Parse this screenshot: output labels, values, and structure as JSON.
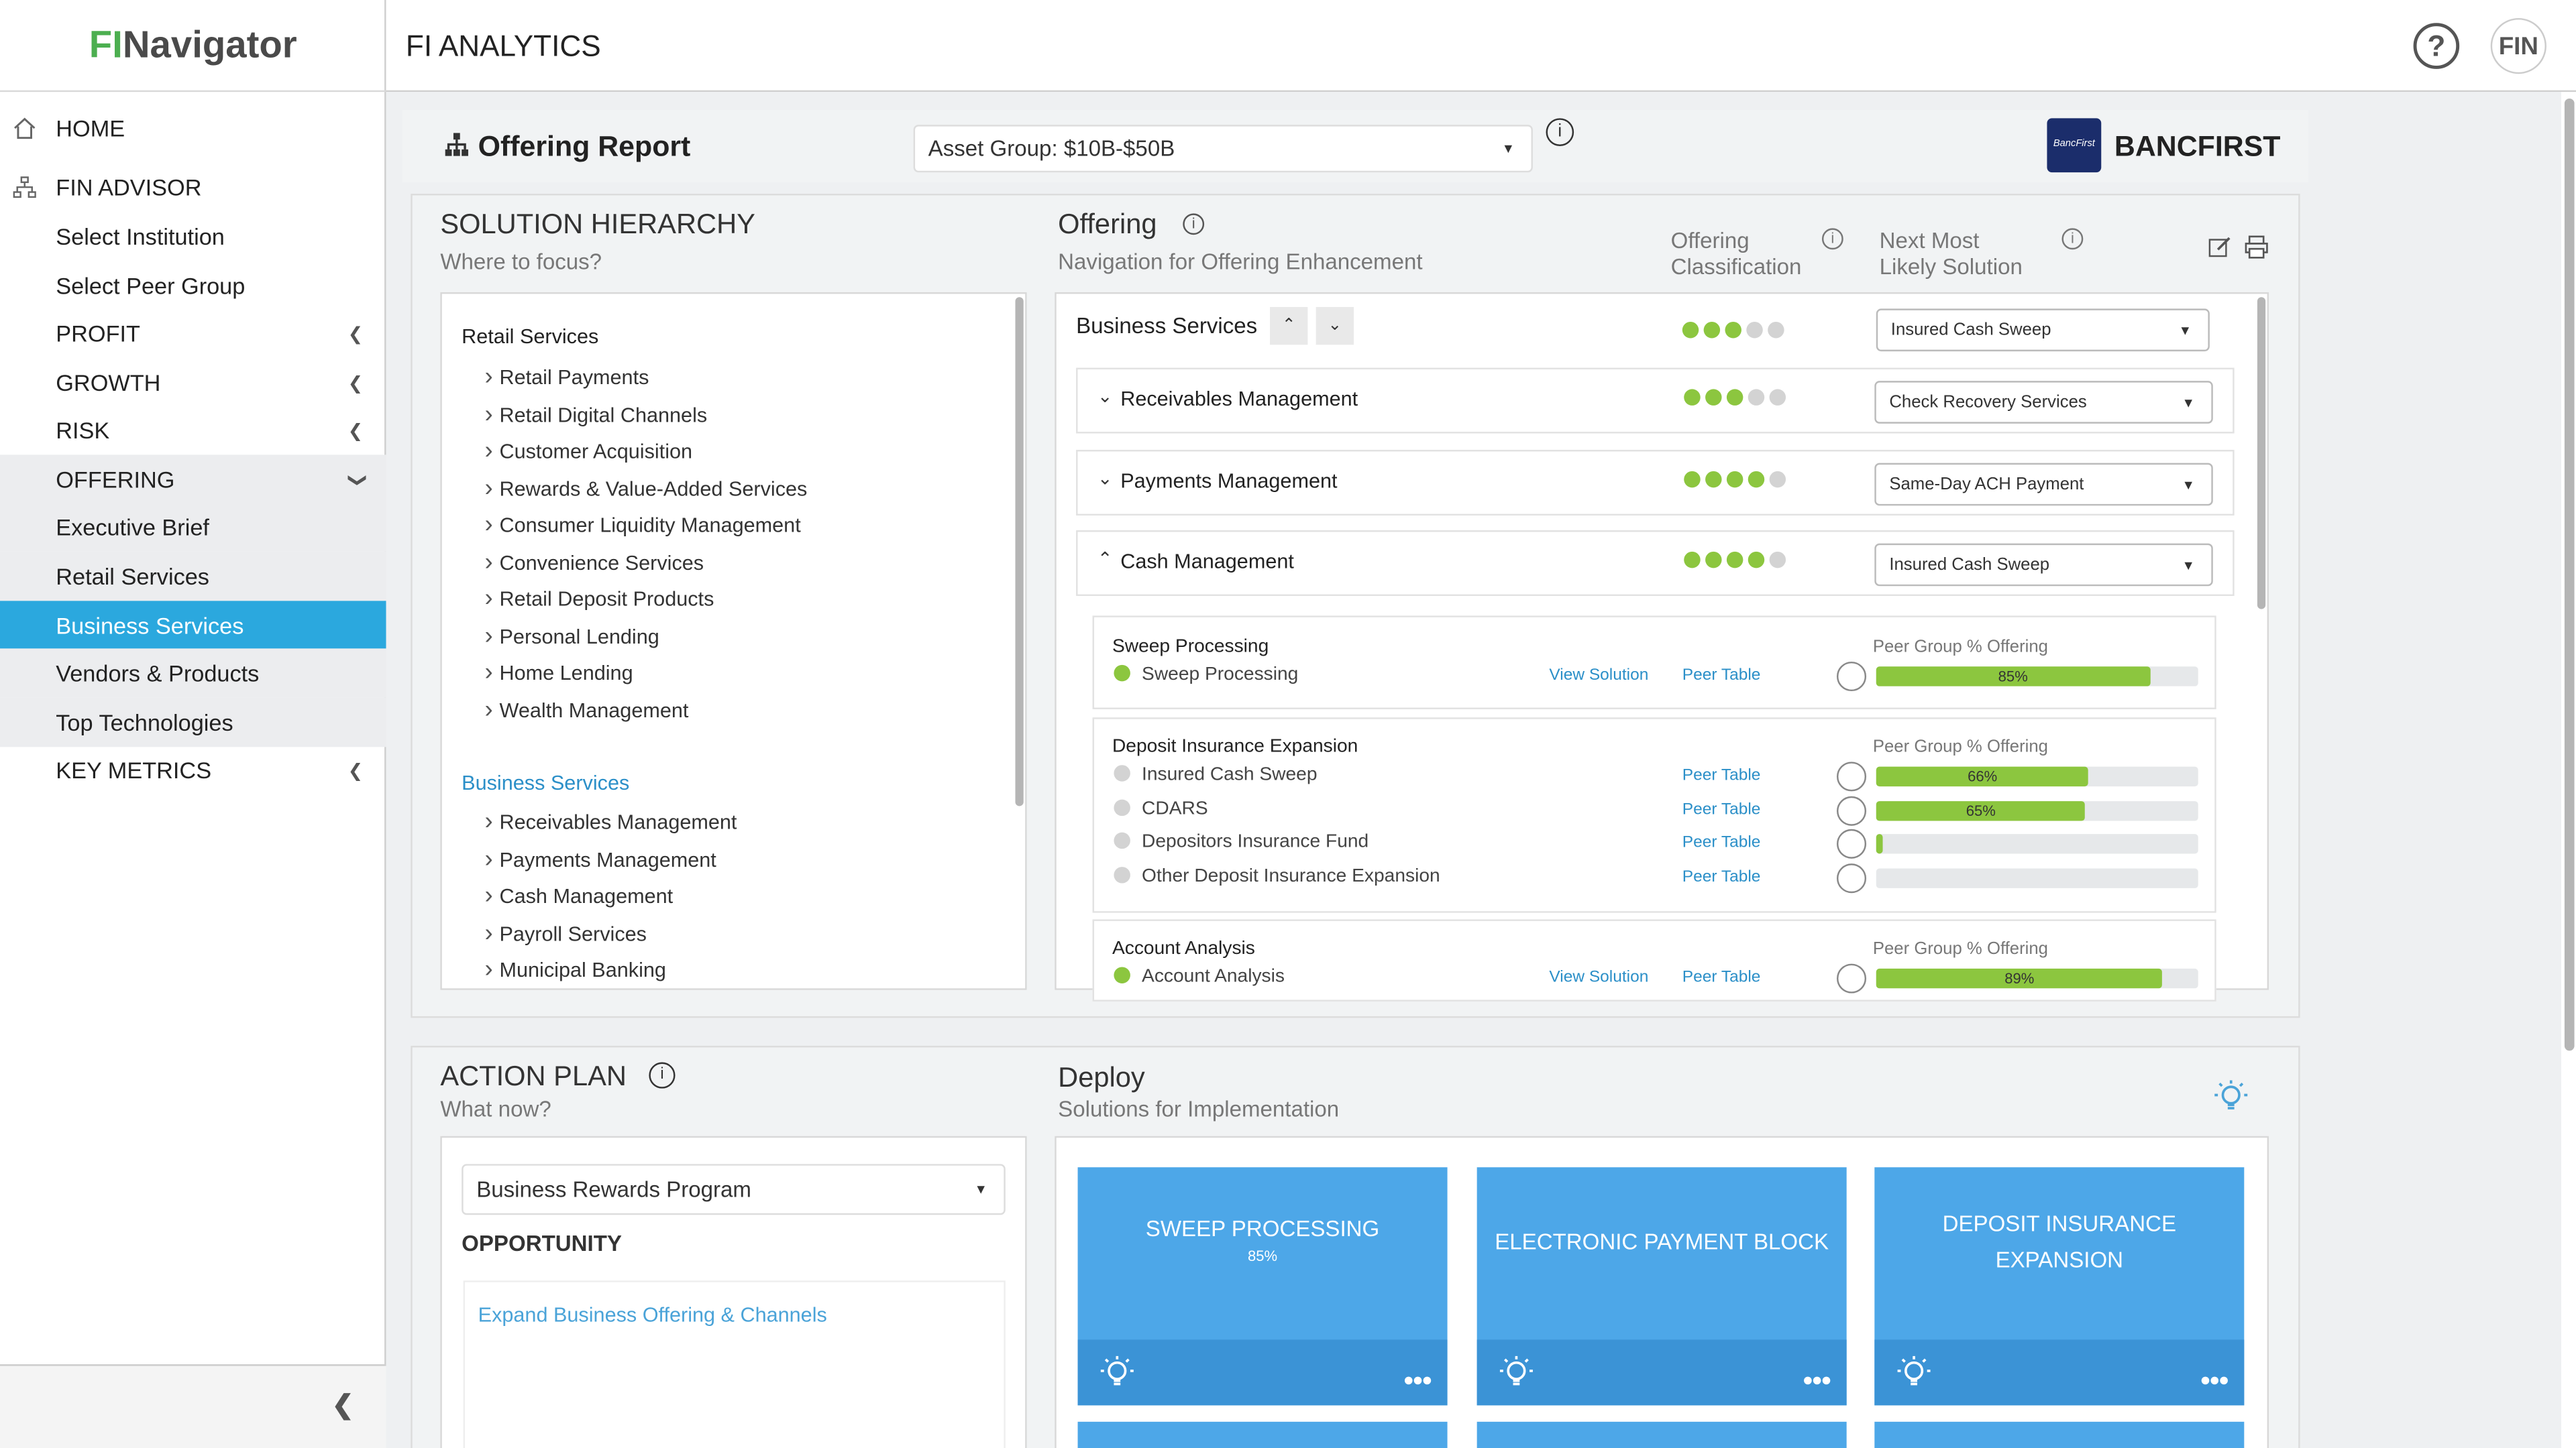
{
  "app": {
    "logo_left": "FI",
    "logo_right": "Navigator",
    "title": "FI ANALYTICS",
    "avatar_text": "FIN",
    "help_icon": "?"
  },
  "sidebar": {
    "items": [
      {
        "label": "HOME"
      },
      {
        "label": "FIN ADVISOR"
      },
      {
        "label": "Select Institution"
      },
      {
        "label": "Select Peer Group"
      },
      {
        "label": "PROFIT"
      },
      {
        "label": "GROWTH"
      },
      {
        "label": "RISK"
      },
      {
        "label": "OFFERING"
      },
      {
        "label": "Executive Brief"
      },
      {
        "label": "Retail Services"
      },
      {
        "label": "Business Services"
      },
      {
        "label": "Vendors & Products"
      },
      {
        "label": "Top Technologies"
      },
      {
        "label": "KEY METRICS"
      }
    ],
    "collapse_icon": "chevron-left-icon"
  },
  "report": {
    "title": "Offering Report",
    "asset_group": "Asset Group: $10B-$50B",
    "institution": "BANCFIRST",
    "institution_logo_text": "BancFirst"
  },
  "hierarchy": {
    "title": "SOLUTION HIERARCHY",
    "subtitle": "Where to focus?",
    "retail_header": "Retail Services",
    "retail_items": [
      "Retail Payments",
      "Retail Digital Channels",
      "Customer Acquisition",
      "Rewards & Value-Added Services",
      "Consumer Liquidity Management",
      "Convenience Services",
      "Retail Deposit Products",
      "Personal Lending",
      "Home Lending",
      "Wealth Management"
    ],
    "business_header": "Business Services",
    "business_items": [
      "Receivables Management",
      "Payments Management",
      "Cash Management",
      "Payroll Services",
      "Municipal Banking"
    ]
  },
  "offering": {
    "title": "Offering",
    "subtitle": "Navigation for Offering Enhancement",
    "col_classification": "Offering Classification",
    "col_next": "Next Most Likely Solution",
    "groups": [
      {
        "label": "Business Services",
        "level": 3,
        "next": "Insured Cash Sweep"
      },
      {
        "label": "Receivables Management",
        "level": 3,
        "next": "Check Recovery Services"
      },
      {
        "label": "Payments Management",
        "level": 4,
        "next": "Same-Day ACH Payment"
      },
      {
        "label": "Cash Management",
        "level": 4,
        "next": "Insured Cash Sweep"
      }
    ],
    "peer_label": "Peer Group % Offering",
    "view_solution": "View Solution",
    "peer_table": "Peer Table",
    "blocks": [
      {
        "title": "Sweep Processing",
        "items": [
          {
            "name": "Sweep Processing",
            "offered": true,
            "pct": 85,
            "pct_label": "85%",
            "view": true
          }
        ]
      },
      {
        "title": "Deposit Insurance Expansion",
        "items": [
          {
            "name": "Insured Cash Sweep",
            "offered": false,
            "pct": 66,
            "pct_label": "66%",
            "view": false
          },
          {
            "name": "CDARS",
            "offered": false,
            "pct": 65,
            "pct_label": "65%",
            "view": false
          },
          {
            "name": "Depositors Insurance Fund",
            "offered": false,
            "pct": 1,
            "pct_label": "",
            "view": false
          },
          {
            "name": "Other Deposit Insurance Expansion",
            "offered": false,
            "pct": 0,
            "pct_label": "",
            "view": false
          }
        ]
      },
      {
        "title": "Account Analysis",
        "items": [
          {
            "name": "Account Analysis",
            "offered": true,
            "pct": 89,
            "pct_label": "89%",
            "view": true
          }
        ]
      }
    ],
    "colors": {
      "on": "#8cc63f",
      "off": "#d3d3d3",
      "link": "#2b8fc8"
    }
  },
  "action": {
    "title": "ACTION PLAN",
    "subtitle": "What now?",
    "select": "Business Rewards Program",
    "opportunity_label": "OPPORTUNITY",
    "opportunity_link": "Expand Business Offering & Channels"
  },
  "deploy": {
    "title": "Deploy",
    "subtitle": "Solutions for Implementation",
    "cards": [
      {
        "title": "SWEEP PROCESSING",
        "sub": "85%"
      },
      {
        "title": "ELECTRONIC PAYMENT BLOCK",
        "sub": ""
      },
      {
        "title": "DEPOSIT INSURANCE EXPANSION",
        "sub": ""
      }
    ],
    "card_color": "#4da7e8"
  }
}
